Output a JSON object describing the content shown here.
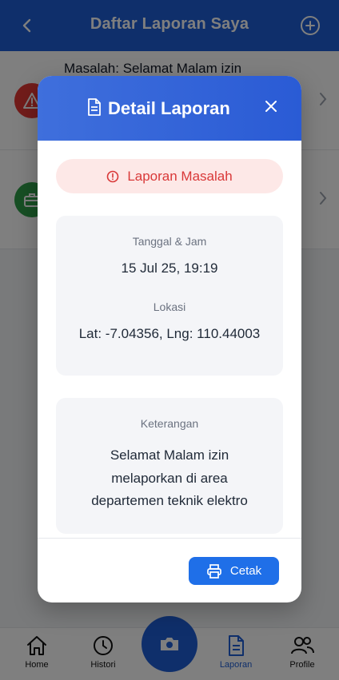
{
  "app_bar": {
    "title": "Daftar Laporan Saya"
  },
  "list": {
    "items": [
      {
        "text": "Masalah: Selamat Malam izin",
        "badge": "warning-icon",
        "color": "#e53935"
      },
      {
        "text": "",
        "badge": "briefcase-icon",
        "color": "#2e9e48"
      }
    ]
  },
  "dialog": {
    "title": "Detail Laporan",
    "status": "Laporan Masalah",
    "datetime_label": "Tanggal & Jam",
    "datetime_value": "15 Jul 25, 19:19",
    "location_label": "Lokasi",
    "location_value": "Lat: -7.04356, Lng: 110.44003",
    "description_label": "Keterangan",
    "description_lines": [
      "Selamat Malam izin",
      "melaporkan di area",
      "departemen teknik elektro"
    ],
    "print_label": "Cetak"
  },
  "tabbar": {
    "items": [
      {
        "label": "Home",
        "icon": "home-icon"
      },
      {
        "label": "Histori",
        "icon": "clock-icon"
      },
      {
        "label": "",
        "icon": "camera-icon"
      },
      {
        "label": "Laporan",
        "icon": "document-icon",
        "active": true
      },
      {
        "label": "Profile",
        "icon": "users-icon"
      }
    ]
  },
  "colors": {
    "primary": "#1f5fd6",
    "danger": "#d93838",
    "success": "#2e9e48"
  }
}
